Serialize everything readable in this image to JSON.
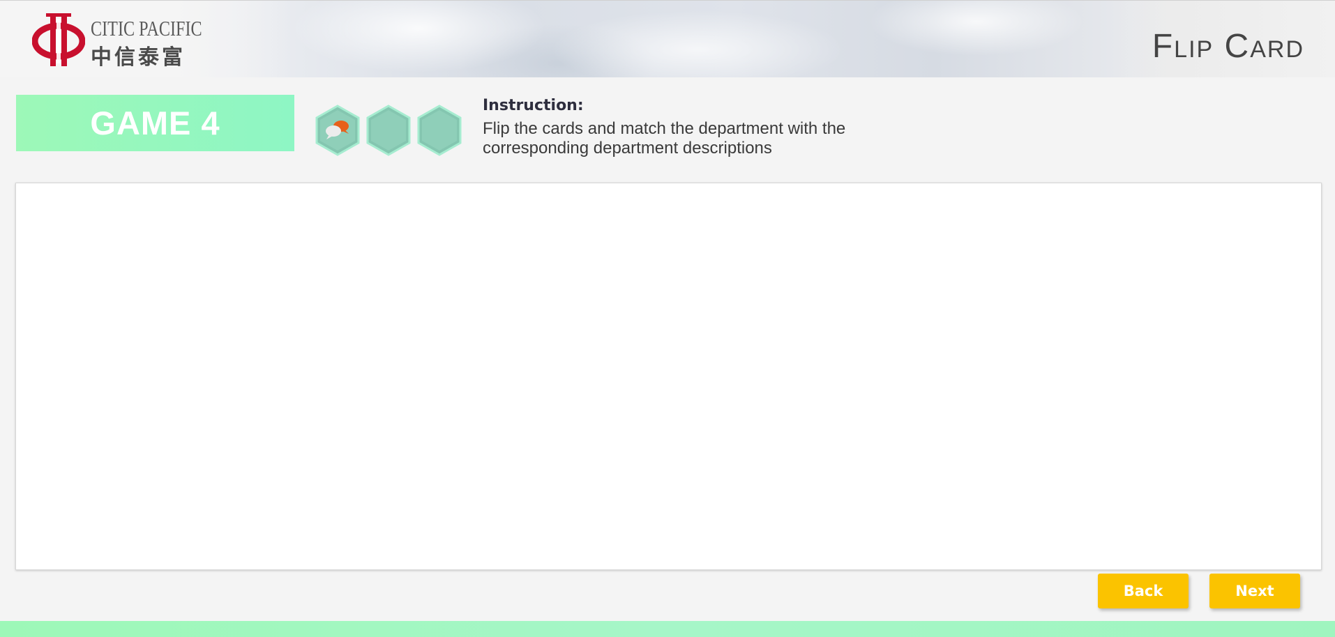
{
  "brand": {
    "name_en": "CITIC PACIFIC",
    "name_cn": "中信泰富",
    "color": "#c8102e"
  },
  "header": {
    "title": "Flip Card"
  },
  "game": {
    "label": "GAME 4",
    "progress": {
      "total": 3,
      "active_index": 0,
      "active_icon": "speech-bubbles-icon"
    }
  },
  "instruction": {
    "heading": "Instruction:",
    "text": "Flip the cards and match the department with the corresponding department descriptions"
  },
  "navigation": {
    "back_label": "Back",
    "next_label": "Next"
  },
  "colors": {
    "accent_green": "#9df8b8",
    "button_yellow": "#fbc300",
    "hex_teal": "#86c8b4"
  }
}
